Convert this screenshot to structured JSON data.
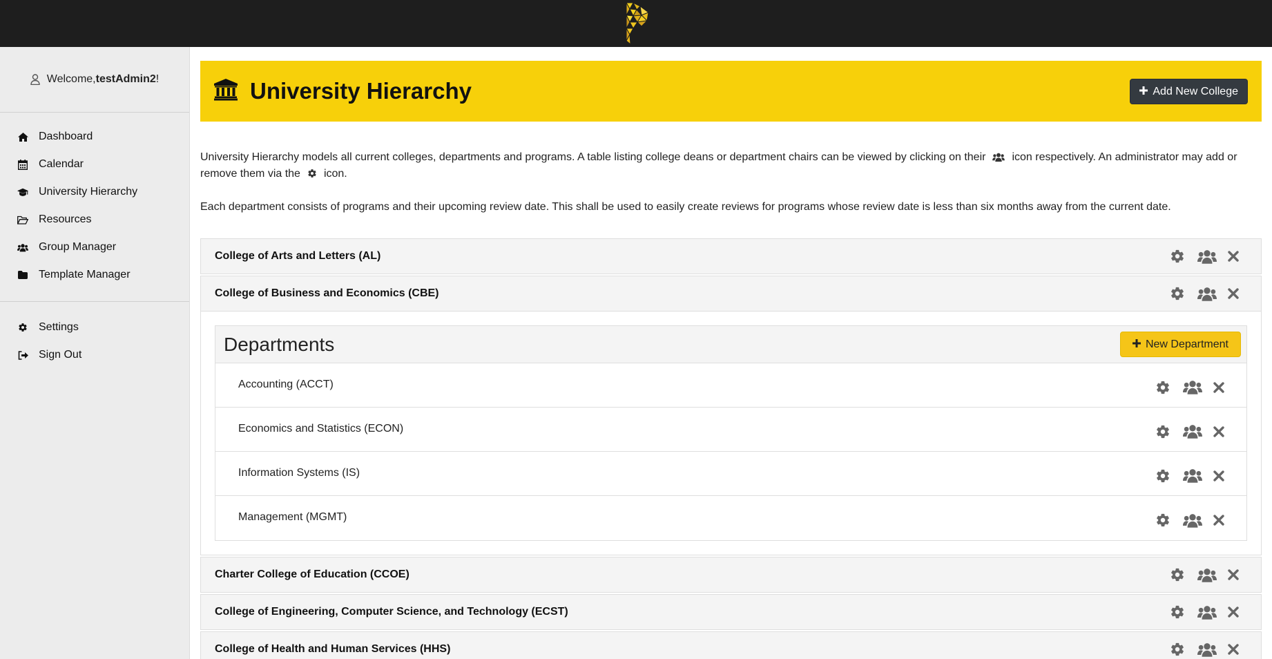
{
  "app": {
    "logo_icon": "yellow-p-triangle-logo"
  },
  "sidebar": {
    "welcome_prefix": "Welcome, ",
    "username": "testAdmin2",
    "welcome_suffix": "!",
    "nav": [
      {
        "label": "Dashboard",
        "icon": "home-icon"
      },
      {
        "label": "Calendar",
        "icon": "calendar-icon"
      },
      {
        "label": "University Hierarchy",
        "icon": "graduation-cap-icon"
      },
      {
        "label": "Resources",
        "icon": "folder-open-icon"
      },
      {
        "label": "Group Manager",
        "icon": "users-icon"
      },
      {
        "label": "Template Manager",
        "icon": "folder-icon"
      }
    ],
    "bottom_nav": [
      {
        "label": "Settings",
        "icon": "gear-icon"
      },
      {
        "label": "Sign Out",
        "icon": "sign-out-icon"
      }
    ]
  },
  "header": {
    "title": "University Hierarchy",
    "title_icon": "university-icon",
    "add_college_label": "Add New College"
  },
  "description": {
    "p1_part1": "University Hierarchy models all current colleges, departments and programs. A table listing college deans or department chairs can be viewed by clicking on their",
    "p1_part2": "icon respectively. An administrator may add or remove them via the",
    "p1_part3": "icon.",
    "p2": "Each department consists of programs and their upcoming review date. This shall be used to easily create reviews for programs whose review date is less than six months away from the current date."
  },
  "colleges": [
    {
      "name": "College of Arts and Letters (AL)",
      "expanded": false
    },
    {
      "name": "College of Business and Economics (CBE)",
      "expanded": true
    },
    {
      "name": "Charter College of Education (CCOE)",
      "expanded": false
    },
    {
      "name": "College of Engineering, Computer Science, and Technology (ECST)",
      "expanded": false
    },
    {
      "name": "College of Health and Human Services (HHS)",
      "expanded": false
    }
  ],
  "departments_panel": {
    "title": "Departments",
    "new_department_label": "New Department",
    "items": [
      "Accounting (ACCT)",
      "Economics and Statistics (ECON)",
      "Information Systems (IS)",
      "Management (MGMT)"
    ]
  },
  "colors": {
    "topbar": "#1e1e1e",
    "accent_yellow": "#f7d00a",
    "button_dark": "#343a40",
    "button_yellow": "#f5c518",
    "icon_gray": "#666666"
  }
}
